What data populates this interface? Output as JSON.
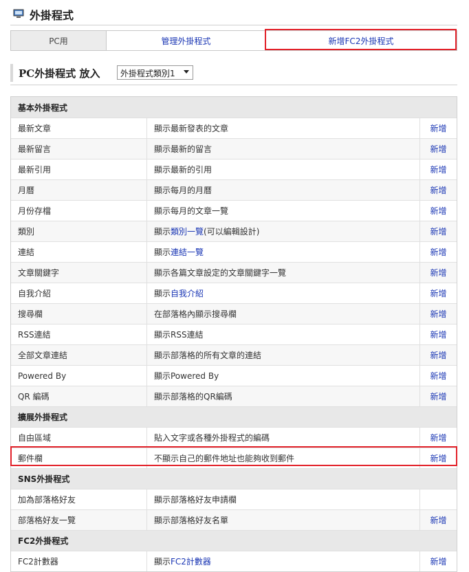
{
  "header": {
    "title": "外掛程式",
    "icon": "monitor-icon"
  },
  "tabs": [
    {
      "label": "PC用"
    },
    {
      "label": "管理外掛程式"
    },
    {
      "label": "新增FC2外掛程式"
    }
  ],
  "selector": {
    "label": "PC外掛程式 放入",
    "value": "外掛程式類別1"
  },
  "sections": {
    "basic": "基本外掛程式",
    "extended": "擴展外掛程式",
    "sns": "SNS外掛程式",
    "fc2": "FC2外掛程式"
  },
  "rows": [
    {
      "name": "最新文章",
      "desc": "顯示最新發表的文章",
      "action": "新增"
    },
    {
      "name": "最新留言",
      "desc": "顯示最新的留言",
      "action": "新增"
    },
    {
      "name": "最新引用",
      "desc": "顯示最新的引用",
      "action": "新增"
    },
    {
      "name": "月曆",
      "desc": "顯示每月的月曆",
      "action": "新增"
    },
    {
      "name": "月份存檔",
      "desc": "顯示每月的文章一覽",
      "action": "新增"
    },
    {
      "name": "類別",
      "desc_prefix": "顯示",
      "desc_link": "類別一覽",
      "desc_suffix": "(可以編輯設計)",
      "action": "新增"
    },
    {
      "name": "連結",
      "desc_prefix": "顯示",
      "desc_link": "連結一覽",
      "action": "新增"
    },
    {
      "name": "文章關鍵字",
      "desc": "顯示各篇文章設定的文章關鍵字一覽",
      "action": "新增"
    },
    {
      "name": "自我介紹",
      "desc_prefix": "顯示",
      "desc_link": "自我介紹",
      "action": "新增"
    },
    {
      "name": "搜尋欄",
      "desc": "在部落格內顯示搜尋欄",
      "action": "新增"
    },
    {
      "name": "RSS連結",
      "desc": "顯示RSS連結",
      "action": "新增"
    },
    {
      "name": "全部文章連結",
      "desc": "顯示部落格的所有文章的連結",
      "action": "新增"
    },
    {
      "name": "Powered By",
      "desc": "顯示Powered By",
      "action": "新增"
    },
    {
      "name": "QR 編碼",
      "desc": "顯示部落格的QR編碼",
      "action": "新增"
    },
    {
      "name": "自由區域",
      "desc": "貼入文字或各種外掛程式的編碼",
      "action": "新增"
    },
    {
      "name": "郵件欄",
      "desc": "不顯示自己的郵件地址也能夠收到郵件",
      "action": "新增"
    },
    {
      "name": "加為部落格好友",
      "desc": "顯示部落格好友申請欄",
      "action": ""
    },
    {
      "name": "部落格好友一覽",
      "desc": "顯示部落格好友名單",
      "action": "新增"
    },
    {
      "name": "FC2計數器",
      "desc_prefix": "顯示",
      "desc_link": "FC2計數器",
      "action": "新增"
    }
  ]
}
